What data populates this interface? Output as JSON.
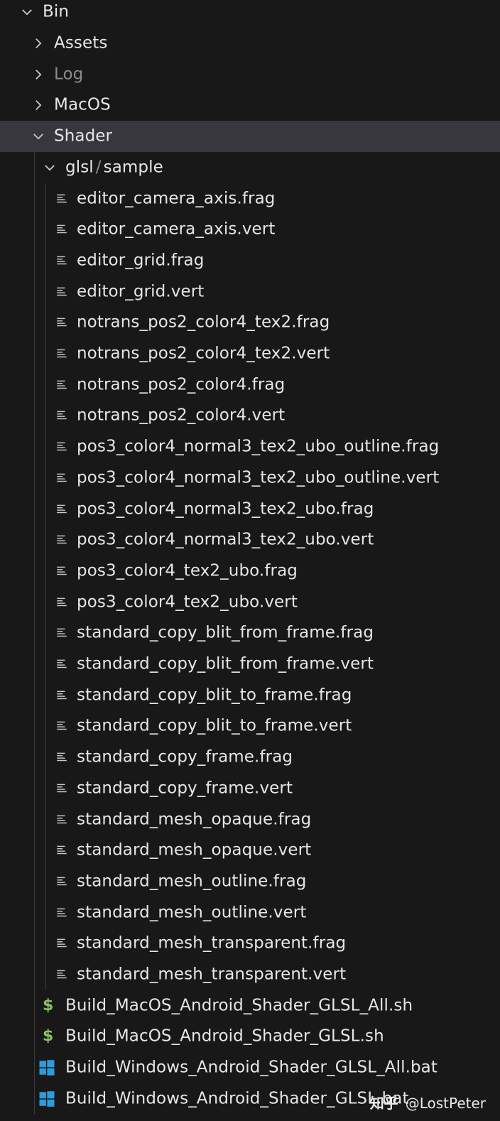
{
  "explorer": {
    "bin": {
      "label": "Bin",
      "expanded": true
    },
    "folders": [
      {
        "label": "Assets",
        "expanded": false,
        "muted": false
      },
      {
        "label": "Log",
        "expanded": false,
        "muted": true
      },
      {
        "label": "MacOS",
        "expanded": false,
        "muted": false
      }
    ],
    "shader": {
      "label": "Shader",
      "expanded": true,
      "selected": true
    },
    "glsl": {
      "label_a": "glsl",
      "separator": "/",
      "label_b": "sample",
      "expanded": true
    },
    "files": [
      "editor_camera_axis.frag",
      "editor_camera_axis.vert",
      "editor_grid.frag",
      "editor_grid.vert",
      "notrans_pos2_color4_tex2.frag",
      "notrans_pos2_color4_tex2.vert",
      "notrans_pos2_color4.frag",
      "notrans_pos2_color4.vert",
      "pos3_color4_normal3_tex2_ubo_outline.frag",
      "pos3_color4_normal3_tex2_ubo_outline.vert",
      "pos3_color4_normal3_tex2_ubo.frag",
      "pos3_color4_normal3_tex2_ubo.vert",
      "pos3_color4_tex2_ubo.frag",
      "pos3_color4_tex2_ubo.vert",
      "standard_copy_blit_from_frame.frag",
      "standard_copy_blit_from_frame.vert",
      "standard_copy_blit_to_frame.frag",
      "standard_copy_blit_to_frame.vert",
      "standard_copy_frame.frag",
      "standard_copy_frame.vert",
      "standard_mesh_opaque.frag",
      "standard_mesh_opaque.vert",
      "standard_mesh_outline.frag",
      "standard_mesh_outline.vert",
      "standard_mesh_transparent.frag",
      "standard_mesh_transparent.vert"
    ],
    "scripts": [
      {
        "label": "Build_MacOS_Android_Shader_GLSL_All.sh",
        "icon": "shell-script-icon"
      },
      {
        "label": "Build_MacOS_Android_Shader_GLSL.sh",
        "icon": "shell-script-icon"
      },
      {
        "label": "Build_Windows_Android_Shader_GLSL_All.bat",
        "icon": "windows-batch-icon"
      },
      {
        "label": "Build_Windows_Android_Shader_GLSL.bat",
        "icon": "windows-batch-icon"
      }
    ]
  },
  "watermark": {
    "site": "知乎",
    "author": "@LostPeter"
  },
  "colors": {
    "background": "#181818",
    "selected_row": "#37373d",
    "text": "#e6e6e6",
    "muted_text": "#8b8b8b",
    "shell_icon": "#8cc265",
    "windows_icon": "#2d9cdb",
    "chevron": "#cccccc"
  }
}
